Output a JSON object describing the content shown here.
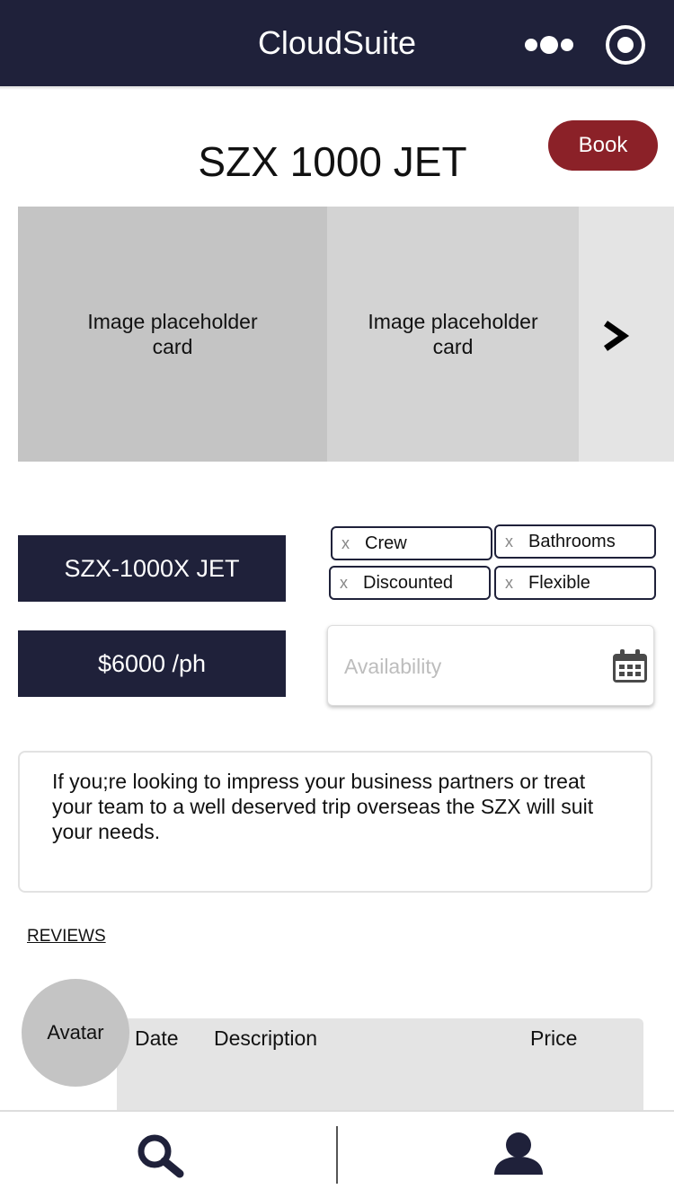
{
  "header": {
    "app_title": "CloudSuite",
    "more_icon": "more-dots-icon",
    "target_icon": "radio-target-icon",
    "bg_color": "#1f213a"
  },
  "listing": {
    "title": "SZX 1000 JET",
    "book_label": "Book",
    "book_color": "#8b2128"
  },
  "carousel": {
    "cards": [
      {
        "label": "Image placeholder card"
      },
      {
        "label": "Image placeholder card"
      }
    ],
    "next_icon": "chevron-right-icon"
  },
  "details": {
    "name_label": "SZX-1000X JET",
    "price_label": "$6000 /ph"
  },
  "filters": {
    "remove_glyph": "x",
    "chips": [
      {
        "label": "Crew"
      },
      {
        "label": "Bathrooms"
      },
      {
        "label": "Discounted"
      },
      {
        "label": "Flexible"
      }
    ]
  },
  "availability": {
    "placeholder": "Availability",
    "icon": "calendar-icon"
  },
  "description": {
    "text": "If you;re looking to impress your business partners or treat your team to a well deserved trip overseas the SZX will suit your needs."
  },
  "reviews": {
    "heading": "REVIEWS",
    "avatar_label": "Avatar",
    "columns": [
      "Date",
      "Description",
      "Price"
    ]
  },
  "bottom_nav": {
    "search_icon": "search-icon",
    "profile_icon": "user-icon"
  }
}
